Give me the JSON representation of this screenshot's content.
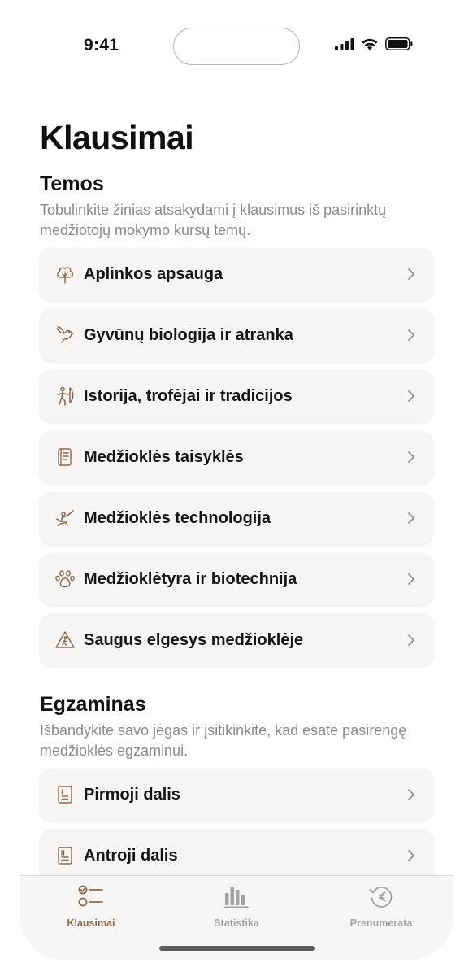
{
  "status_bar": {
    "time": "9:41"
  },
  "page": {
    "title": "Klausimai"
  },
  "topics": {
    "title": "Temos",
    "description": "Tobulinkite žinias atsakydami į klausimus iš pasirinktų medžiotojų mokymo kursų temų.",
    "items": [
      {
        "label": "Aplinkos apsauga",
        "icon": "tree-icon"
      },
      {
        "label": "Gyvūnų biologija ir atranka",
        "icon": "bird-icon"
      },
      {
        "label": "Istorija, trofėjai ir tradicijos",
        "icon": "archer-icon"
      },
      {
        "label": "Medžioklės taisyklės",
        "icon": "rulebook-icon"
      },
      {
        "label": "Medžioklės technologija",
        "icon": "hunter-icon"
      },
      {
        "label": "Medžioklėtyra ir biotechnija",
        "icon": "paw-icon"
      },
      {
        "label": "Saugus elgesys medžioklėje",
        "icon": "warning-icon"
      }
    ]
  },
  "exam": {
    "title": "Egzaminas",
    "description": "Išbandykite savo jėgas ir įsitikinkite, kad esate pasirengę medžioklės egzaminui.",
    "items": [
      {
        "label": "Pirmoji dalis",
        "icon": "part-one-icon"
      },
      {
        "label": "Antroji dalis",
        "icon": "part-two-icon"
      }
    ]
  },
  "tabbar": {
    "tabs": [
      {
        "label": "Klausimai",
        "icon": "checklist-icon",
        "active": true
      },
      {
        "label": "Statistika",
        "icon": "bar-chart-icon",
        "active": false
      },
      {
        "label": "Prenumerata",
        "icon": "euro-subscription-icon",
        "active": false
      }
    ]
  },
  "colors": {
    "accent": "#8b6a4f",
    "inactive": "#a3a3a3",
    "row_background": "#f6f5f4",
    "secondary_text": "#8a8a8a"
  }
}
